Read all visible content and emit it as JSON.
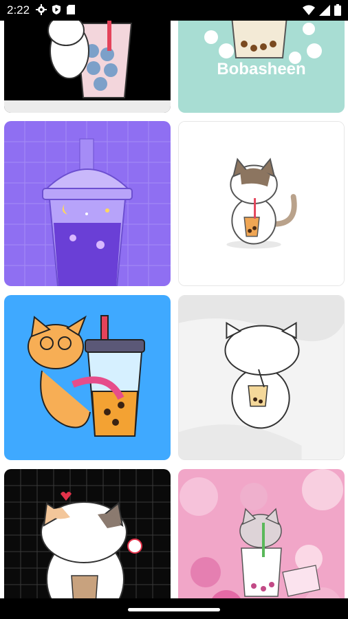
{
  "status_bar": {
    "time": "2:22",
    "left_icons": [
      "gear-icon",
      "shield-play-icon",
      "sd-card-icon"
    ],
    "right_icons": [
      "wifi-icon",
      "signal-icon",
      "battery-icon"
    ]
  },
  "wallpapers": [
    {
      "id": "w1",
      "name": "wallpaper-cat-boba-black"
    },
    {
      "id": "w2",
      "name": "wallpaper-bobasheen",
      "caption": "Bobasheen"
    },
    {
      "id": "w3",
      "name": "wallpaper-purple-boba-cup"
    },
    {
      "id": "w4",
      "name": "wallpaper-calico-cat-boba"
    },
    {
      "id": "w5",
      "name": "wallpaper-orange-cat-boba"
    },
    {
      "id": "w6",
      "name": "wallpaper-white-cat-boba"
    },
    {
      "id": "w7",
      "name": "wallpaper-cat-boba-grid"
    },
    {
      "id": "w8",
      "name": "wallpaper-pink-cat-boba"
    }
  ],
  "colors": {
    "mint": "#a8ddd3",
    "purple": "#8f6ff2",
    "blue": "#3fa9ff",
    "pink": "#f1a6c8"
  }
}
